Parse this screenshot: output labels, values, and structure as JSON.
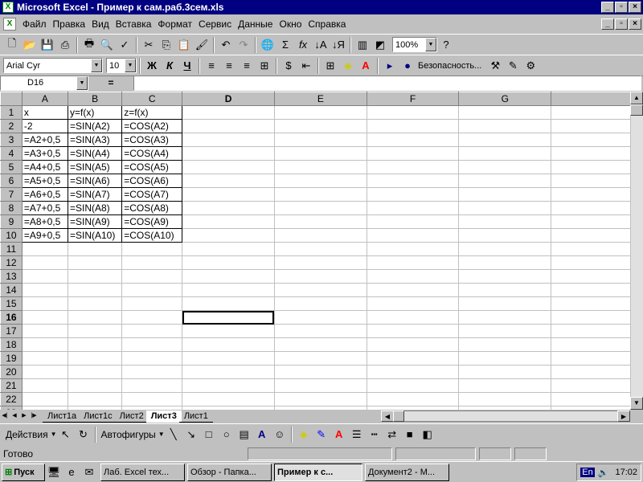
{
  "window": {
    "title": "Microsoft Excel - Пример к сам.раб.3сем.xls"
  },
  "menu": [
    "Файл",
    "Правка",
    "Вид",
    "Вставка",
    "Формат",
    "Сервис",
    "Данные",
    "Окно",
    "Справка"
  ],
  "toolbar": {
    "zoom": "100%",
    "font": "Arial Cyr",
    "font_size": "10",
    "security": "Безопасность...",
    "bold": "Ж",
    "italic": "К",
    "underline": "Ч"
  },
  "formula": {
    "cell": "D16",
    "eq": "="
  },
  "columns": [
    "A",
    "B",
    "C",
    "D",
    "E",
    "F",
    "G"
  ],
  "rows": [
    [
      "x",
      "y=f(x)",
      "z=f(x)"
    ],
    [
      "-2",
      "=SIN(A2)",
      "=COS(A2)"
    ],
    [
      "=A2+0,5",
      "=SIN(A3)",
      "=COS(A3)"
    ],
    [
      "=A3+0,5",
      "=SIN(A4)",
      "=COS(A4)"
    ],
    [
      "=A4+0,5",
      "=SIN(A5)",
      "=COS(A5)"
    ],
    [
      "=A5+0,5",
      "=SIN(A6)",
      "=COS(A6)"
    ],
    [
      "=A6+0,5",
      "=SIN(A7)",
      "=COS(A7)"
    ],
    [
      "=A7+0,5",
      "=SIN(A8)",
      "=COS(A8)"
    ],
    [
      "=A8+0,5",
      "=SIN(A9)",
      "=COS(A9)"
    ],
    [
      "=A9+0,5",
      "=SIN(A10)",
      "=COS(A10)"
    ]
  ],
  "row_count": 23,
  "selected_row": 16,
  "selected_col": "D",
  "tabs": [
    "Лист1а",
    "Лист1с",
    "Лист2",
    "Лист3",
    "Лист1"
  ],
  "active_tab": "Лист3",
  "drawing": {
    "actions": "Действия",
    "autoshapes": "Автофигуры"
  },
  "status": {
    "text": "Готово"
  },
  "taskbar": {
    "start": "Пуск",
    "tasks": [
      "Лаб. Excel тех...",
      "Обзор - Папка...",
      "Пример к с...",
      "Документ2 - М..."
    ],
    "active": 2,
    "lang": "En",
    "time": "17:02"
  }
}
